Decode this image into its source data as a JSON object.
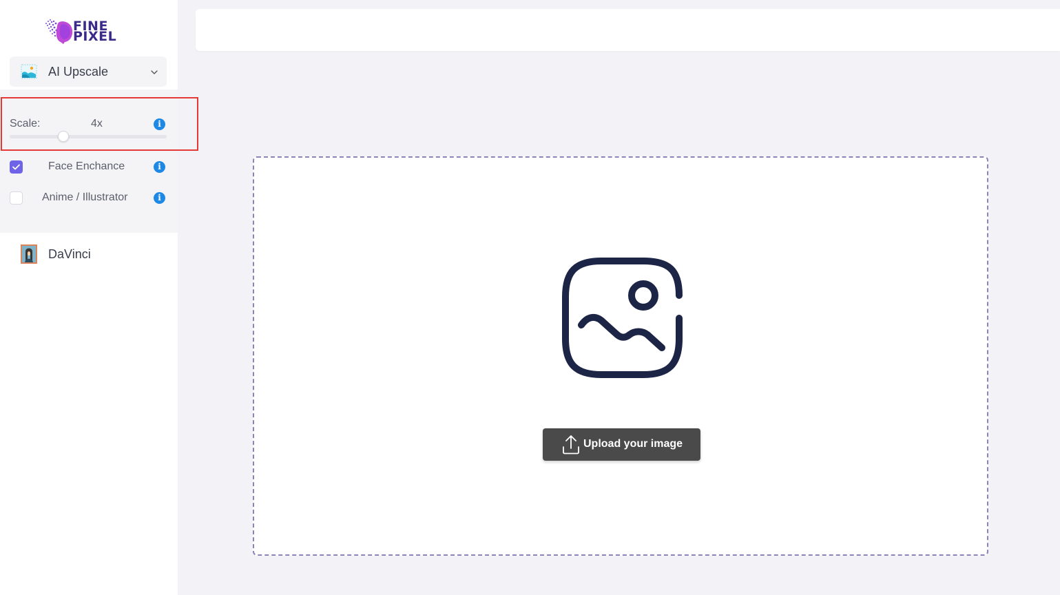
{
  "brand": {
    "logo_line1": "FINE",
    "logo_line2": "PIXEL",
    "logo_icon": "brain-pixel-logo"
  },
  "tool_selector": {
    "label": "AI Upscale",
    "icon": "image-upscale-icon",
    "chevron": "chevron-down-icon"
  },
  "options": {
    "scale_label": "Scale:",
    "scale_value": "4x",
    "scale_slider_fraction": 0.34,
    "info_glyph": "i",
    "face_enhance_label": "Face Enchance",
    "face_enhance_checked": true,
    "anime_label": "Anime / Illustrator",
    "anime_checked": false
  },
  "secondary_tool": {
    "label": "DaVinci",
    "icon": "portrait-painting-icon"
  },
  "upload": {
    "button_label": "Upload your image",
    "placeholder_icon": "image-icon",
    "button_icon": "upload-icon"
  },
  "colors": {
    "accent": "#6f63e8",
    "info": "#1e88e5",
    "highlight": "#e53935",
    "upload_button": "#4a4a4a",
    "dropzone_border": "#8a84b8",
    "image_icon": "#1c2546"
  }
}
